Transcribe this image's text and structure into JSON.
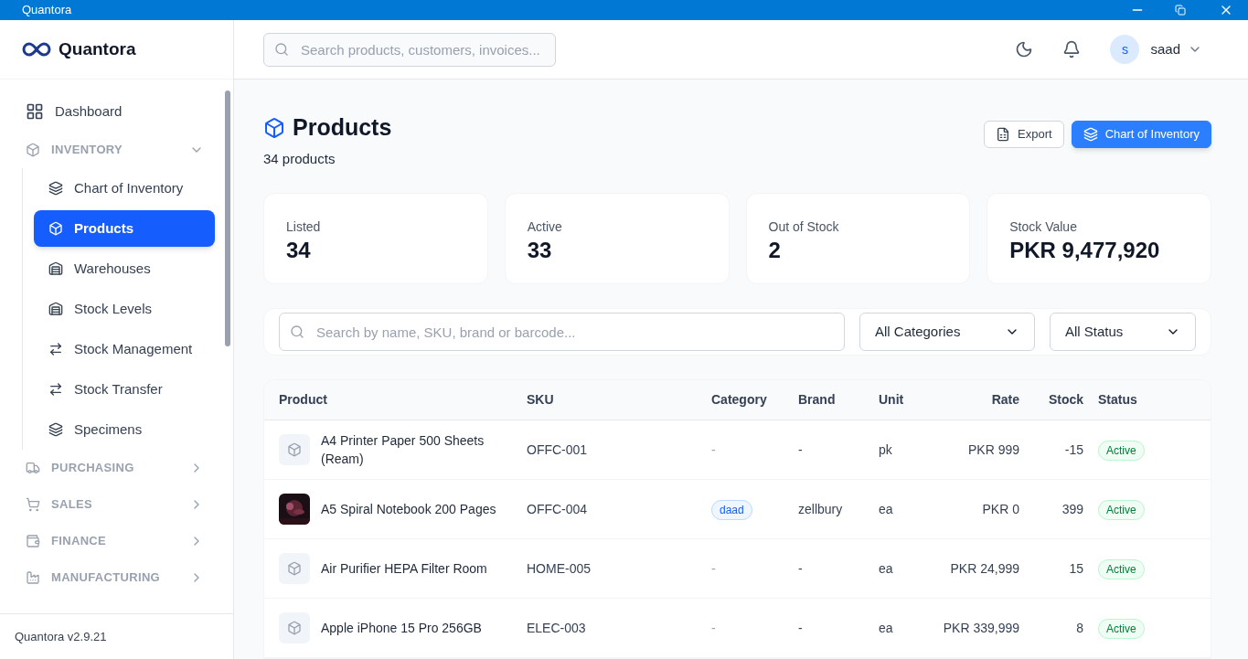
{
  "window": {
    "title": "Quantora"
  },
  "brand": {
    "name": "Quantora"
  },
  "sidebar": {
    "items": [
      {
        "kind": "link",
        "label": "Dashboard",
        "selected": false
      },
      {
        "kind": "section",
        "label": "INVENTORY",
        "expanded": true,
        "children": [
          {
            "label": "Chart of Inventory",
            "selected": false
          },
          {
            "label": "Products",
            "selected": true
          },
          {
            "label": "Warehouses",
            "selected": false
          },
          {
            "label": "Stock Levels",
            "selected": false
          },
          {
            "label": "Stock Management",
            "selected": false
          },
          {
            "label": "Stock Transfer",
            "selected": false
          },
          {
            "label": "Specimens",
            "selected": false
          }
        ]
      },
      {
        "kind": "section",
        "label": "PURCHASING",
        "expanded": false
      },
      {
        "kind": "section",
        "label": "SALES",
        "expanded": false
      },
      {
        "kind": "section",
        "label": "FINANCE",
        "expanded": false
      },
      {
        "kind": "section",
        "label": "MANUFACTURING",
        "expanded": false
      }
    ],
    "version": "Quantora v2.9.21"
  },
  "header": {
    "search": {
      "placeholder": "Search products, customers, invoices..."
    },
    "user": {
      "initial": "s",
      "name": "saad"
    }
  },
  "page": {
    "title": "Products",
    "subtitle": "34 products",
    "buttons": [
      {
        "kind": "outline",
        "label": "Export"
      },
      {
        "kind": "primary",
        "label": "Chart of Inventory"
      }
    ]
  },
  "stats": [
    {
      "label": "Listed",
      "value": "34"
    },
    {
      "label": "Active",
      "value": "33"
    },
    {
      "label": "Out of Stock",
      "value": "2"
    },
    {
      "label": "Stock Value",
      "value": "PKR 9,477,920"
    }
  ],
  "filters": {
    "search": {
      "placeholder": "Search by name, SKU, brand or barcode..."
    },
    "category": "All Categories",
    "status": "All Status"
  },
  "table": {
    "columns": [
      "Product",
      "SKU",
      "Category",
      "Brand",
      "Unit",
      "Rate",
      "Stock",
      "Status"
    ],
    "rows": [
      {
        "kind": "placeholder",
        "product": "A4 Printer Paper 500 Sheets (Ream)",
        "sku": "OFFC-001",
        "category": {
          "kind": "none",
          "text": "-"
        },
        "brand": "-",
        "unit": "pk",
        "rate": "PKR 999",
        "stock": "-15",
        "status": "Active"
      },
      {
        "kind": "picture",
        "product": "A5 Spiral Notebook 200 Pages",
        "sku": "OFFC-004",
        "category": {
          "kind": "tag",
          "text": "daad"
        },
        "brand": "zellbury",
        "unit": "ea",
        "rate": "PKR 0",
        "stock": "399",
        "status": "Active"
      },
      {
        "kind": "placeholder",
        "product": "Air Purifier HEPA Filter Room",
        "sku": "HOME-005",
        "category": {
          "kind": "none",
          "text": "-"
        },
        "brand": "-",
        "unit": "ea",
        "rate": "PKR 24,999",
        "stock": "15",
        "status": "Active"
      },
      {
        "kind": "placeholder",
        "product": "Apple iPhone 15 Pro 256GB",
        "sku": "ELEC-003",
        "category": {
          "kind": "none",
          "text": "-"
        },
        "brand": "-",
        "unit": "ea",
        "rate": "PKR 339,999",
        "stock": "8",
        "status": "Active"
      }
    ]
  }
}
